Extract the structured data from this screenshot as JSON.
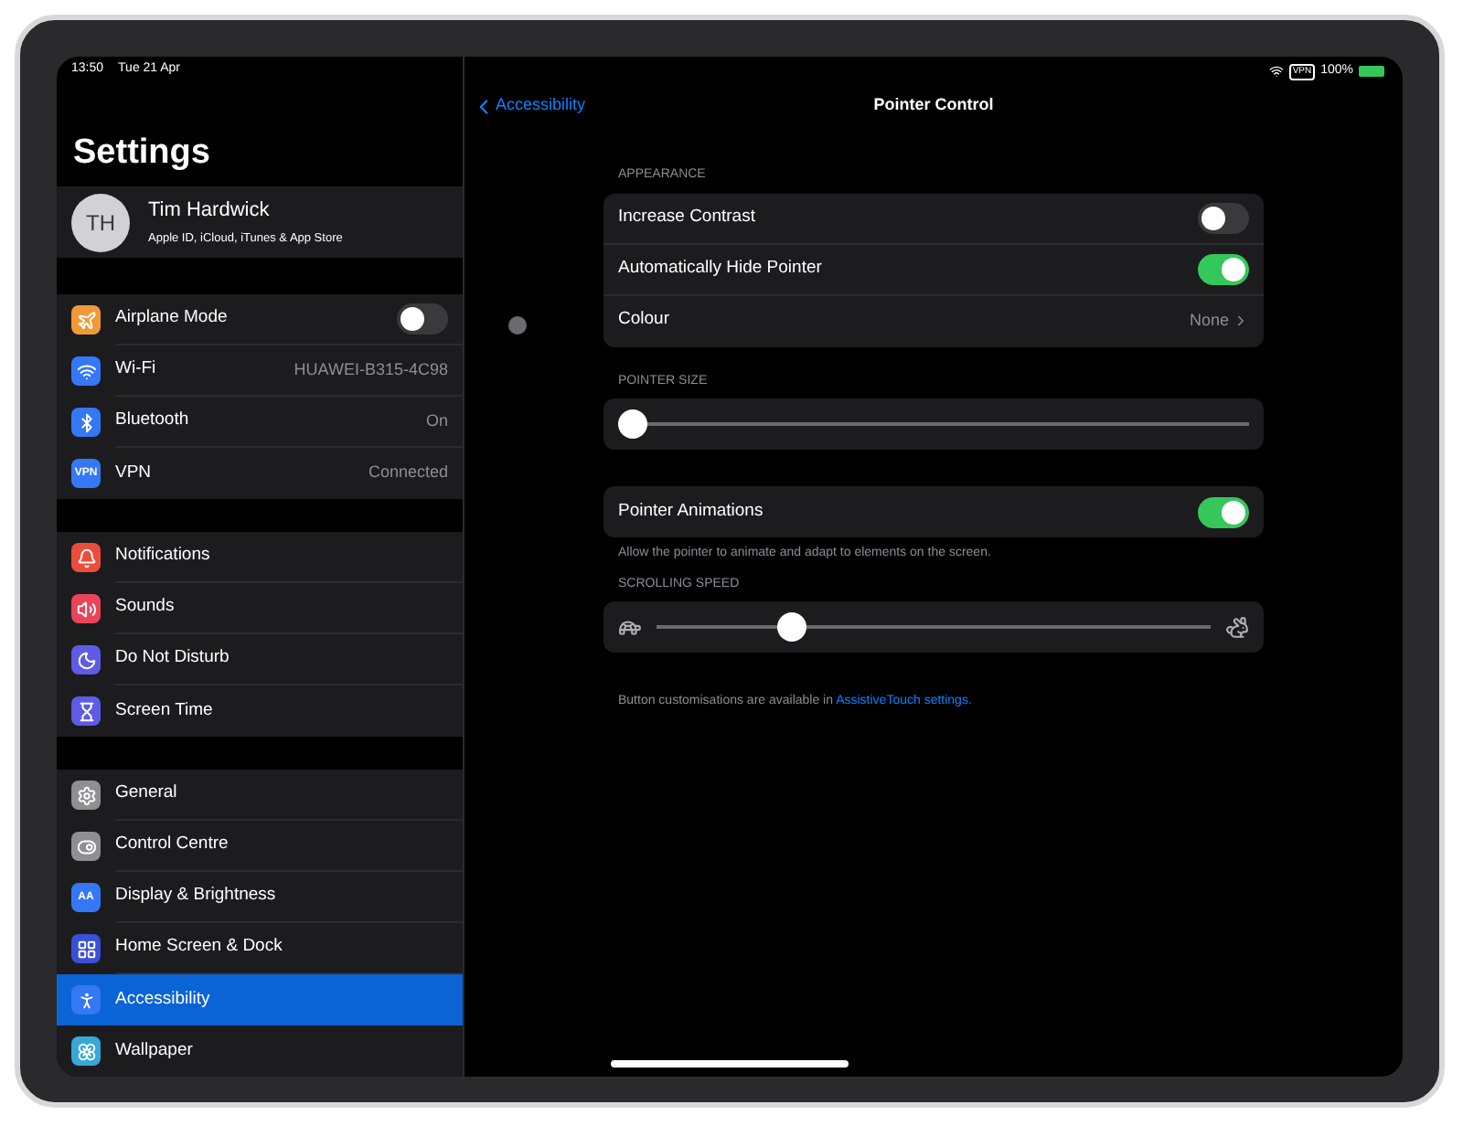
{
  "status_bar": {
    "time": "13:50",
    "date": "Tue 21 Apr",
    "vpn_badge": "VPN",
    "battery": "100%"
  },
  "sidebar": {
    "title": "Settings",
    "profile": {
      "initials": "TH",
      "name": "Tim Hardwick",
      "subtitle": "Apple ID, iCloud, iTunes & App Store"
    },
    "groups": [
      [
        {
          "label": "Airplane Mode",
          "kind": "toggle",
          "on": false,
          "selected": false,
          "color": "#f09a37"
        },
        {
          "label": "Wi-Fi",
          "kind": "value",
          "value": "HUAWEI-B315-4C98",
          "selected": false,
          "color": "#3478f6"
        },
        {
          "label": "Bluetooth",
          "kind": "value",
          "value": "On",
          "selected": false,
          "color": "#3478f6"
        },
        {
          "label": "VPN",
          "kind": "value",
          "value": "Connected",
          "selected": false,
          "color": "#3478f6",
          "icon_text": "VPN"
        }
      ],
      [
        {
          "label": "Notifications",
          "kind": "link",
          "selected": false,
          "color": "#eb4d3d"
        },
        {
          "label": "Sounds",
          "kind": "link",
          "selected": false,
          "color": "#eb445a"
        },
        {
          "label": "Do Not Disturb",
          "kind": "link",
          "selected": false,
          "color": "#5e5ce6"
        },
        {
          "label": "Screen Time",
          "kind": "link",
          "selected": false,
          "color": "#5e5ce6"
        }
      ],
      [
        {
          "label": "General",
          "kind": "link",
          "selected": false,
          "color": "#8e8e93"
        },
        {
          "label": "Control Centre",
          "kind": "link",
          "selected": false,
          "color": "#8e8e93"
        },
        {
          "label": "Display & Brightness",
          "kind": "link",
          "selected": false,
          "color": "#3478f6",
          "icon_text": "AA"
        },
        {
          "label": "Home Screen & Dock",
          "kind": "link",
          "selected": false,
          "color": "#3a50d9"
        },
        {
          "label": "Accessibility",
          "kind": "link",
          "selected": true,
          "color": "#3478f6"
        },
        {
          "label": "Wallpaper",
          "kind": "link",
          "selected": false,
          "color": "#38a8d6"
        }
      ]
    ]
  },
  "detail": {
    "back": "Accessibility",
    "title": "Pointer Control",
    "sections": [
      {
        "kind": "list",
        "header": "APPEARANCE",
        "rows": [
          {
            "label": "Increase Contrast",
            "kind": "toggle",
            "on": false
          },
          {
            "label": "Automatically Hide Pointer",
            "kind": "toggle",
            "on": true
          },
          {
            "label": "Colour",
            "kind": "value",
            "value": "None"
          }
        ]
      },
      {
        "kind": "slider",
        "header": "POINTER SIZE",
        "level": 0
      },
      {
        "kind": "list",
        "rows": [
          {
            "label": "Pointer Animations",
            "kind": "toggle",
            "on": true
          }
        ],
        "footer": "Allow the pointer to animate and adapt to elements on the screen."
      },
      {
        "kind": "speed",
        "header": "SCROLLING SPEED",
        "level": 0.23
      }
    ],
    "note": {
      "text": "Button customisations are available in ",
      "link": "AssistiveTouch settings."
    }
  }
}
